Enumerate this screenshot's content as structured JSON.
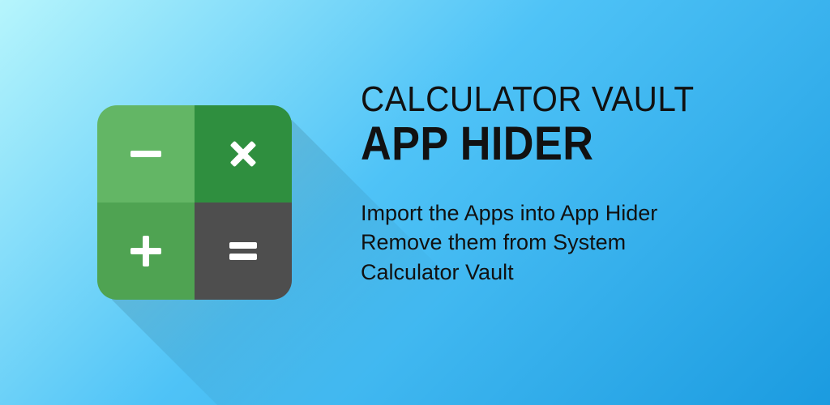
{
  "header": {
    "line1": "CALCULATOR VAULT",
    "line2": "APP HIDER"
  },
  "description": {
    "line1": "Import the Apps into App Hider",
    "line2": "Remove them from System",
    "line3": "Calculator Vault"
  },
  "icon": {
    "name": "calculator-app-icon",
    "quadrants": {
      "top_left": "minus",
      "top_right": "multiply",
      "bottom_left": "plus",
      "bottom_right": "equals"
    },
    "colors": {
      "tl": "#63b665",
      "tr": "#2f8f3f",
      "bl": "#4fa352",
      "br": "#4e4e4e",
      "symbol": "#ffffff"
    }
  }
}
